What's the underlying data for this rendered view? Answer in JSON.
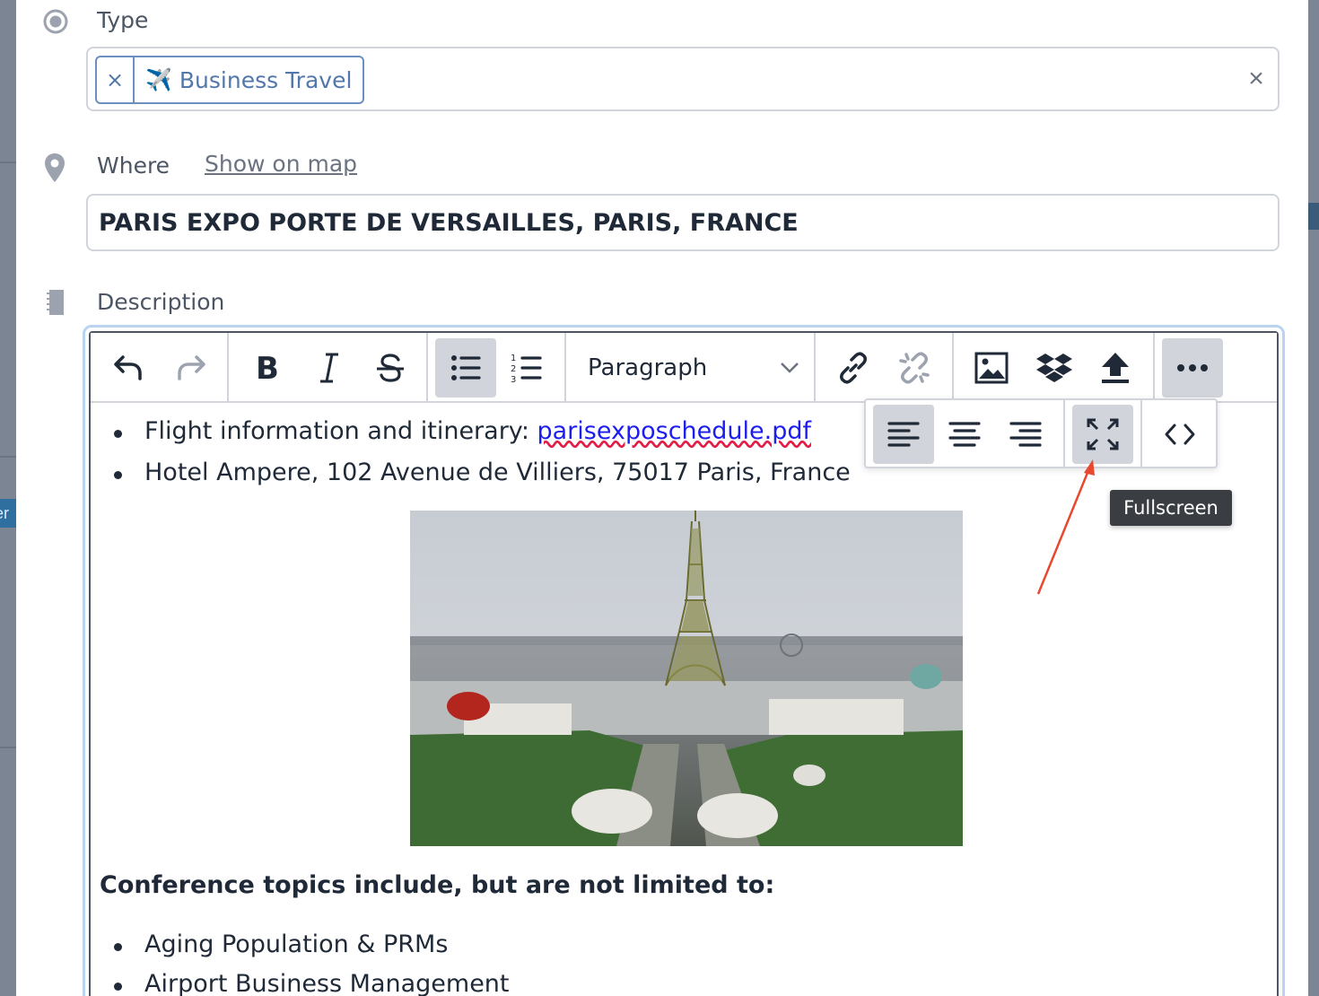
{
  "background": {
    "left_badge_text": "er"
  },
  "type_field": {
    "label": "Type",
    "tag_remove": "×",
    "tag_emoji": "✈️",
    "tag_label": "Business Travel",
    "clear": "×"
  },
  "where_field": {
    "label": "Where",
    "map_link": "Show on map",
    "value": "PARIS EXPO PORTE DE VERSAILLES, PARIS, FRANCE"
  },
  "description_field": {
    "label": "Description",
    "block_format": "Paragraph"
  },
  "toolbar": {
    "buttons": [
      "undo",
      "redo",
      "bold",
      "italic",
      "strikethrough",
      "bullet-list",
      "numbered-list",
      "link",
      "unlink",
      "image",
      "dropbox",
      "upload",
      "more"
    ],
    "active": [
      "bullet-list",
      "more"
    ]
  },
  "more_menu": {
    "buttons": [
      "align-left",
      "align-center",
      "align-right",
      "fullscreen",
      "source-code"
    ],
    "tooltip": "Fullscreen"
  },
  "content": {
    "bullets_top": [
      {
        "prefix": "Flight information and itinerary: ",
        "link": "parisexposchedule.pdf"
      },
      {
        "text": "Hotel Ampere, 102 Avenue de Villiers, 75017 Paris, France"
      }
    ],
    "heading": "Conference topics include, but are not limited to:",
    "bullets_bottom": [
      "Aging Population & PRMs",
      "Airport Business Management"
    ]
  },
  "colors": {
    "accent": "#5277aa",
    "link": "#1d1df0",
    "focus_ring": "#b9d3f0",
    "annotation_arrow": "#e8492e"
  }
}
